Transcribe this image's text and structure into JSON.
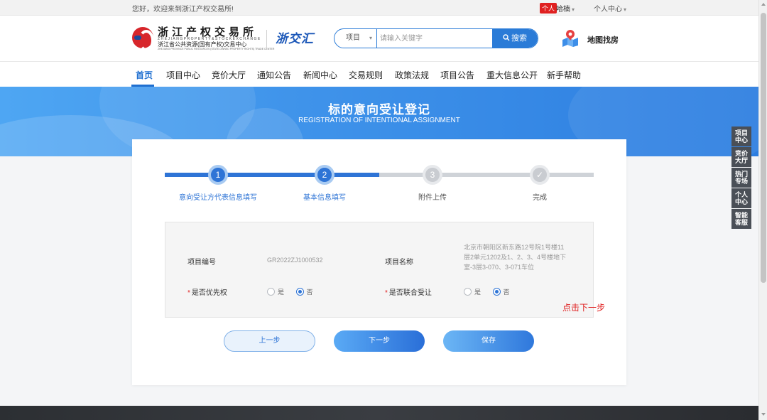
{
  "topbar": {
    "welcome": "您好，欢迎来到浙江产权交易所!",
    "user_tag": "个人",
    "user_name": "哈楠",
    "user_center": "个人中心"
  },
  "header": {
    "logo_name": "浙江产权交易所",
    "logo_pinyin": "ZHEJIANGPROPERTY&STOCKEXCHANGE",
    "logo_sub": "浙江省公共资源(国有产权)交易中心",
    "logo_sub_en": "ZHEJIANG PROVINCE PUBLIC RESOURCES (STATE-OWNED PROPERTY RIGHTS) TRADE CENTER",
    "logo2": "浙交汇",
    "search_category": "项目",
    "search_placeholder": "请输入关键字",
    "search_button": "搜索",
    "map_label": "地图找房"
  },
  "nav": {
    "items": [
      "首页",
      "项目中心",
      "竞价大厅",
      "通知公告",
      "新闻中心",
      "交易规则",
      "政策法规",
      "项目公告",
      "重大信息公开",
      "新手帮助"
    ],
    "active_index": 0
  },
  "banner": {
    "title": "标的意向受让登记",
    "subtitle": "REGISTRATION OF INTENTIONAL ASSIGNMENT"
  },
  "steps": {
    "progress": 0.5,
    "items": [
      {
        "num": "1",
        "label": "意向受让方代表信息填写",
        "state": "done"
      },
      {
        "num": "2",
        "label": "基本信息填写",
        "state": "done"
      },
      {
        "num": "3",
        "label": "附件上传",
        "state": "todo"
      },
      {
        "num": "✓",
        "label": "完成",
        "state": "todo"
      }
    ]
  },
  "form": {
    "project_no_label": "项目编号",
    "project_no_value": "GR2022ZJ1000532",
    "project_name_label": "项目名称",
    "project_name_value": "北京市朝阳区新东路12号院1号楼11层2单元1202及1、2、3、4号楼地下室-3层3-070、3-071车位",
    "priority_label": "是否优先权",
    "joint_label": "是否联合受让",
    "required_mark": "*",
    "opt_yes": "是",
    "opt_no": "否",
    "priority_selected": "否",
    "joint_selected": "否"
  },
  "hint": "点击下一步",
  "buttons": {
    "prev": "上一步",
    "next": "下一步",
    "save": "保存"
  },
  "float_nav": [
    "项目中心",
    "竞价大厅",
    "热门专场",
    "个人中心",
    "智能客服"
  ],
  "colors": {
    "primary": "#2e74d6",
    "danger": "#e02020",
    "banner": "#3f93ea"
  }
}
